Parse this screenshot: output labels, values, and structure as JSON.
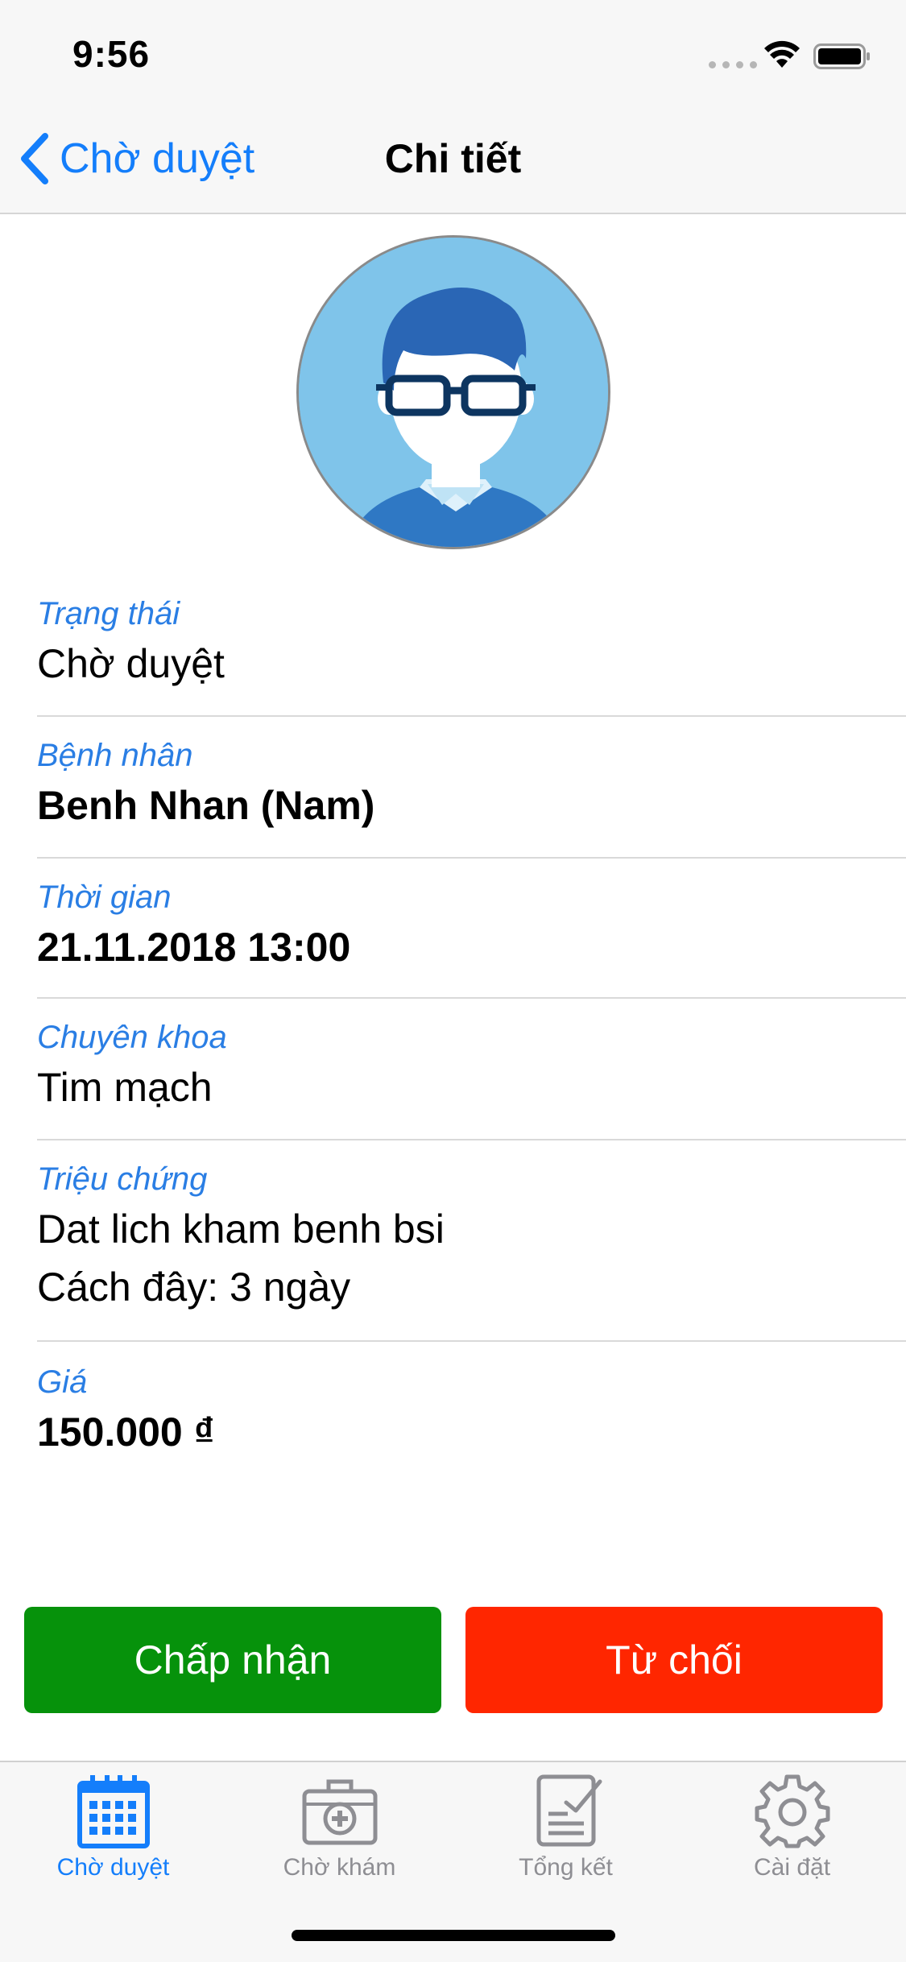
{
  "status_bar": {
    "time": "9:56"
  },
  "nav": {
    "back_label": "Chờ duyệt",
    "title": "Chi tiết"
  },
  "details": [
    {
      "label": "Trạng thái",
      "value": "Chờ duyệt",
      "bold": false
    },
    {
      "label": "Bệnh nhân",
      "value": "Benh Nhan (Nam)",
      "bold": true
    },
    {
      "label": "Thời gian",
      "value": "21.11.2018 13:00",
      "bold": true
    },
    {
      "label": "Chuyên khoa",
      "value": "Tim mạch",
      "bold": false
    },
    {
      "label": "Triệu chứng",
      "value": "Dat lich kham benh bsi",
      "extra": "Cách đây: 3 ngày",
      "bold": false
    },
    {
      "label": "Giá",
      "value": "150.000 ₫",
      "bold": true
    }
  ],
  "actions": {
    "accept_label": "Chấp nhận",
    "reject_label": "Từ chối"
  },
  "tabs": [
    {
      "label": "Chờ duyệt",
      "icon": "calendar-icon",
      "active": true
    },
    {
      "label": "Chờ khám",
      "icon": "medical-kit-icon",
      "active": false
    },
    {
      "label": "Tổng kết",
      "icon": "checklist-icon",
      "active": false
    },
    {
      "label": "Cài đặt",
      "icon": "gear-icon",
      "active": false
    }
  ],
  "colors": {
    "accent": "#147efb",
    "label_blue": "#2a7ee4",
    "accept_green": "#06920b",
    "reject_red": "#ff2600",
    "inactive_gray": "#8e8e93"
  }
}
